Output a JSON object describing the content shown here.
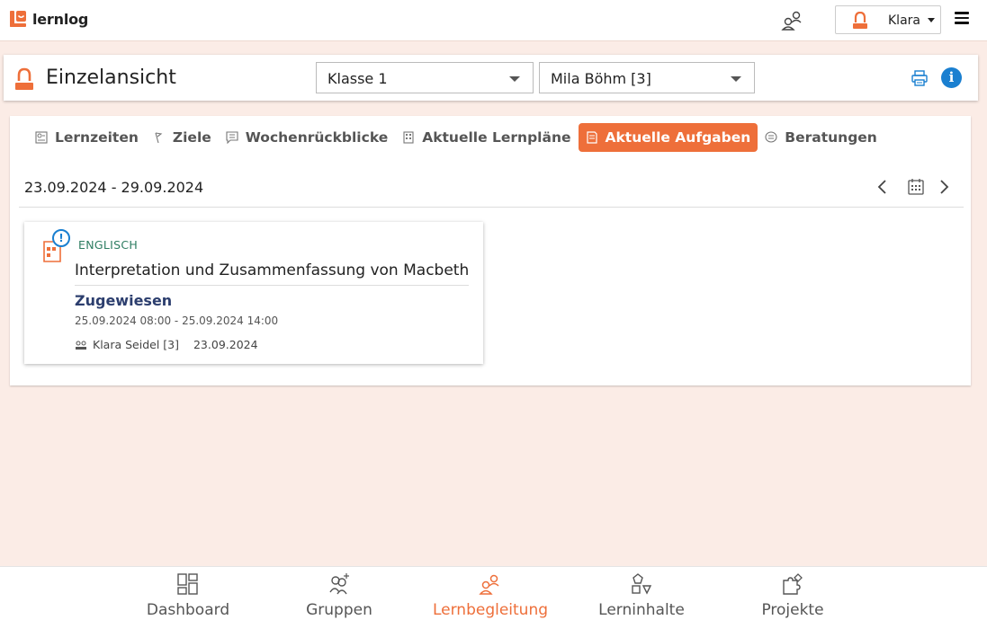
{
  "app": {
    "name": "lernlog"
  },
  "user": {
    "name": "Klara"
  },
  "header": {
    "title": "Einzelansicht",
    "class_select": "Klasse 1",
    "student_select": "Mila Böhm [3]"
  },
  "tabs": [
    {
      "label": "Lernzeiten",
      "active": false
    },
    {
      "label": "Ziele",
      "active": false
    },
    {
      "label": "Wochenrückblicke",
      "active": false
    },
    {
      "label": "Aktuelle Lernpläne",
      "active": false
    },
    {
      "label": "Aktuelle Aufgaben",
      "active": true
    },
    {
      "label": "Beratungen",
      "active": false
    }
  ],
  "date_range": "23.09.2024 - 29.09.2024",
  "task": {
    "subject": "ENGLISCH",
    "title": "Interpretation und Zusammenfassung von Macbeth",
    "status": "Zugewiesen",
    "period": "25.09.2024 08:00 - 25.09.2024 14:00",
    "assigned_by": "Klara Seidel [3]",
    "assigned_date": "23.09.2024",
    "alert": "!"
  },
  "bottom_nav": [
    {
      "label": "Dashboard",
      "active": false
    },
    {
      "label": "Gruppen",
      "active": false
    },
    {
      "label": "Lernbegleitung",
      "active": true
    },
    {
      "label": "Lerninhalte",
      "active": false
    },
    {
      "label": "Projekte",
      "active": false
    }
  ],
  "colors": {
    "accent": "#ee6f3a",
    "info": "#1a7fd0",
    "subject": "#2e7d62",
    "status": "#2c3e6e",
    "background": "#fbece6"
  },
  "icons": {
    "logo": "lernlog-logo-icon",
    "switch_role": "person-switch-icon",
    "user": "person-icon",
    "menu": "hamburger-menu-icon",
    "print": "printer-icon",
    "info": "info-icon",
    "calendar": "calendar-icon",
    "prev": "chevron-left-icon",
    "next": "chevron-right-icon"
  }
}
